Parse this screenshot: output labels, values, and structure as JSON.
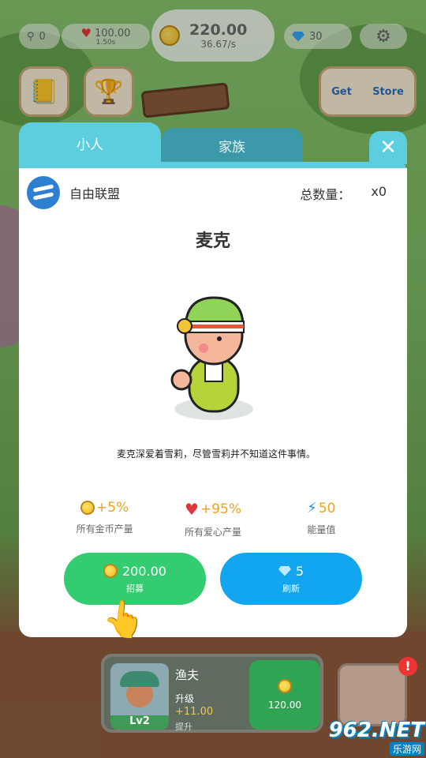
{
  "hud": {
    "pins": "0",
    "hearts": "100.00",
    "hearts_sub": "1.50s",
    "money": "220.00",
    "money_rate": "36.67/s",
    "gems": "30",
    "get_label": "Get",
    "store_label": "Store"
  },
  "tabs": {
    "active": "小人",
    "inactive": "家族"
  },
  "modal": {
    "close_symbol": "✕",
    "faction_name": "自由联盟",
    "total_label": "总数量：",
    "total_value": "x0",
    "char_name": "麦克",
    "description": "麦克深爱着雪莉，尽管雪莉并不知道这件事情。",
    "stats": [
      {
        "value": "+5%",
        "label": "所有金币产量",
        "icon": "coin-icon"
      },
      {
        "value": "+95%",
        "label": "所有爱心产量",
        "icon": "heart-icon"
      },
      {
        "value": "50",
        "label": "能量值",
        "icon": "lightning-icon"
      }
    ],
    "recruit": {
      "price": "200.00",
      "label": "招募"
    },
    "refresh": {
      "price": "5",
      "label": "刷新"
    }
  },
  "worker": {
    "title": "渔夫",
    "level": "Lv2",
    "upgrade_label": "升级",
    "bonus": "+11.00",
    "promote": "提升",
    "cost": "120.00"
  },
  "alert": "!",
  "watermark": {
    "main": "962.NET",
    "sub": "乐游网"
  },
  "colors": {
    "tab_active": "#5dcde0",
    "tab_inactive": "#3b99a9",
    "recruit_green": "#34cc70",
    "refresh_blue": "#12a5f0",
    "stat_orange": "#f0a020"
  }
}
